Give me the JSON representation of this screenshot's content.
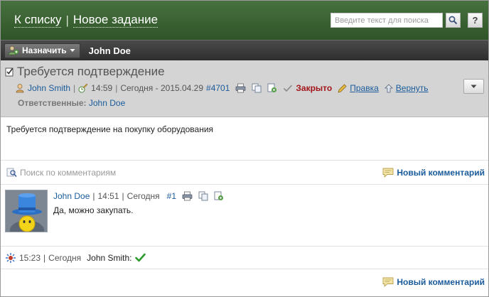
{
  "header": {
    "back_link": "К списку",
    "separator": "|",
    "new_task_link": "Новое задание",
    "search_placeholder": "Введите текст для поиска",
    "help_label": "?"
  },
  "toolbar": {
    "assign_label": "Назначить",
    "assignee": "John Doe"
  },
  "task": {
    "title": "Требуется подтверждение",
    "author": "John Smith",
    "time": "14:59",
    "date_text": "Сегодня - 2015.04.29",
    "number": "#4701",
    "status": "Закрыто",
    "edit_label": "Правка",
    "return_label": "Вернуть",
    "responsible_label": "Ответственные:",
    "responsible_name": "John Doe",
    "description": "Требуется подтверждение на покупку оборудования"
  },
  "comments_bar": {
    "search_label": "Поиск по комментариям",
    "new_comment_label": "Новый комментарий"
  },
  "comment": {
    "author": "John Doe",
    "time": "14:51",
    "day": "Сегодня",
    "number": "#1",
    "text": "Да, можно закупать."
  },
  "event": {
    "time": "15:23",
    "day": "Сегодня",
    "user": "John Smith:"
  },
  "footer": {
    "new_comment_label": "Новый комментарий"
  },
  "colors": {
    "header_green": "#3a6132",
    "link_blue": "#1a5b9b",
    "status_red": "#a2161a",
    "check_green": "#2d9a2d"
  },
  "sep": "|"
}
